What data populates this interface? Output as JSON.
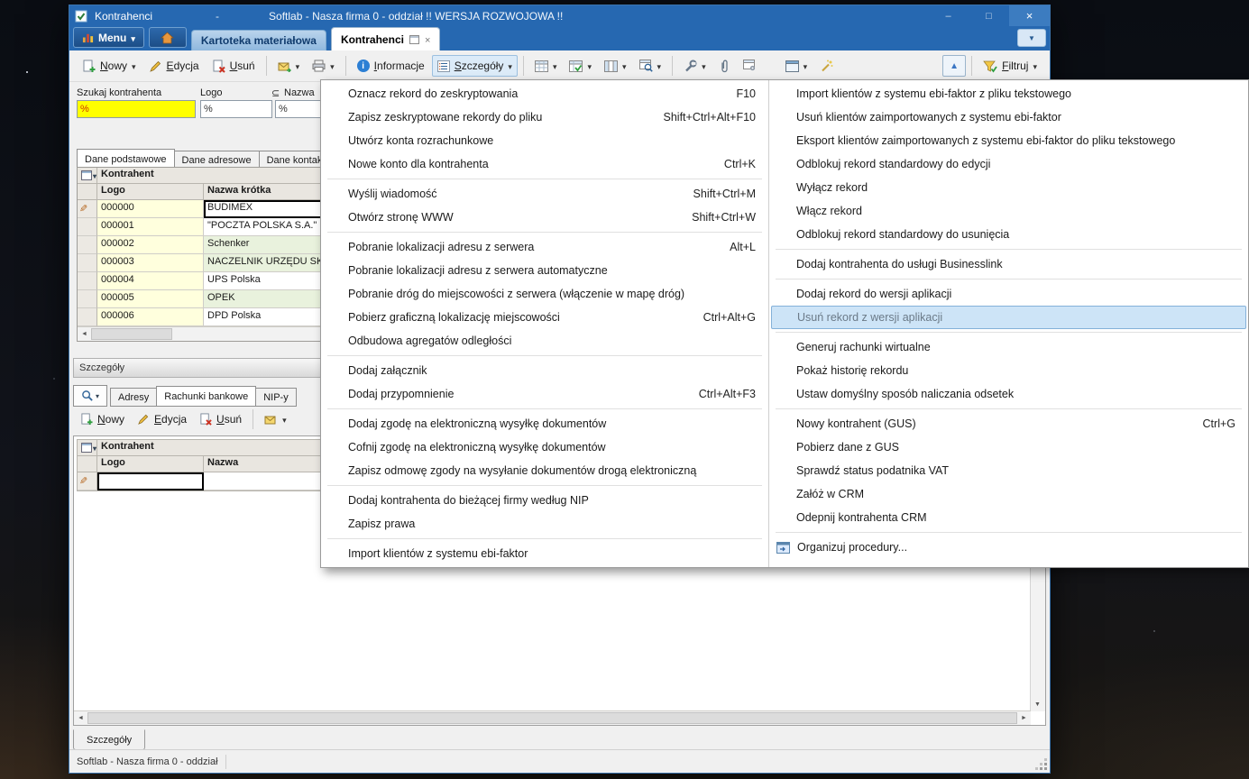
{
  "colors": {
    "titlebar": "#2668b1",
    "accent": "#2c7fd4",
    "search_highlight": "#ffff00",
    "grid_logo_cell": "#ffffdd",
    "grid_alt_row": "#e9f2dd",
    "menu_highlight_bg": "#cde4f7",
    "menu_highlight_border": "#84b1d9"
  },
  "icons": [
    "app-check-icon",
    "bar-chart-icon",
    "home-icon",
    "new-doc-icon",
    "pencil-icon",
    "delete-doc-icon",
    "envelope-icon",
    "printer-icon",
    "info-icon",
    "list-icon",
    "grid-icon",
    "grid-check-icon",
    "columns-icon",
    "grid-search-icon",
    "wrench-icon",
    "paperclip-icon",
    "grid-gear-icon",
    "window-icon",
    "magic-wand-icon",
    "up-arrow-icon",
    "funnel-icon",
    "magnifier-icon",
    "procedures-icon"
  ],
  "window": {
    "app_name": "Kontrahenci",
    "separator": "-",
    "title": "Softlab - Nasza firma 0 - oddział !! WERSJA ROZWOJOWA !!",
    "controls": {
      "minimize": "–",
      "maximize": "□",
      "close": "×"
    }
  },
  "menubar": {
    "menu_label": "Menu",
    "tabs": [
      {
        "label": "Kartoteka materiałowa"
      },
      {
        "label": "Kontrahenci"
      }
    ]
  },
  "toolbar": {
    "nowy": "Nowy",
    "edycja": "Edycja",
    "usun": "Usuń",
    "informacje": "Informacje",
    "szczegoly": "Szczegóły",
    "filtruj": "Filtruj"
  },
  "search": {
    "operator": "⊆",
    "fields": [
      {
        "label": "Szukaj kontrahenta",
        "value": "%"
      },
      {
        "label": "Logo",
        "value": "%"
      },
      {
        "label": "Nazwa",
        "value": "%"
      }
    ]
  },
  "main_tabs": [
    {
      "label": "Dane podstawowe"
    },
    {
      "label": "Dane adresowe"
    },
    {
      "label": "Dane kontaktowe"
    }
  ],
  "grid": {
    "group_header": "Kontrahent",
    "columns": [
      "Logo",
      "Nazwa krótka"
    ],
    "rows": [
      {
        "logo": "000000",
        "nazwa": "BUDIMEX"
      },
      {
        "logo": "000001",
        "nazwa": "\"POCZTA POLSKA S.A.\""
      },
      {
        "logo": "000002",
        "nazwa": "Schenker"
      },
      {
        "logo": "000003",
        "nazwa": "NACZELNIK URZĘDU SK"
      },
      {
        "logo": "000004",
        "nazwa": "UPS Polska"
      },
      {
        "logo": "000005",
        "nazwa": "OPEK"
      },
      {
        "logo": "000006",
        "nazwa": "DPD Polska"
      }
    ]
  },
  "details": {
    "panel_header": "Szczegóły",
    "tabs": [
      {
        "label": "Adresy"
      },
      {
        "label": "Rachunki bankowe"
      },
      {
        "label": "NIP-y"
      }
    ],
    "toolbar": {
      "nowy": "Nowy",
      "edycja": "Edycja",
      "usun": "Usuń"
    },
    "grid": {
      "group_header": "Kontrahent",
      "columns": [
        "Logo",
        "Nazwa"
      ]
    },
    "bottom_tab": "Szczegóły"
  },
  "context_menu": {
    "columns": [
      {
        "groups": [
          {
            "items": [
              {
                "label": "Oznacz rekord do zeskryptowania",
                "shortcut": "F10"
              },
              {
                "label": "Zapisz zeskryptowane rekordy do pliku",
                "shortcut": "Shift+Ctrl+Alt+F10"
              },
              {
                "label": "Utwórz konta rozrachunkowe"
              },
              {
                "label": "Nowe konto dla kontrahenta",
                "shortcut": "Ctrl+K"
              }
            ]
          },
          {
            "items": [
              {
                "label": "Wyślij wiadomość",
                "shortcut": "Shift+Ctrl+M"
              },
              {
                "label": "Otwórz stronę WWW",
                "shortcut": "Shift+Ctrl+W"
              }
            ]
          },
          {
            "items": [
              {
                "label": "Pobranie lokalizacji adresu z serwera",
                "shortcut": "Alt+L"
              },
              {
                "label": "Pobranie lokalizacji adresu z serwera automatyczne"
              },
              {
                "label": "Pobranie dróg do miejscowości z serwera (włączenie w mapę dróg)"
              },
              {
                "label": "Pobierz graficzną lokalizację miejscowości",
                "shortcut": "Ctrl+Alt+G"
              },
              {
                "label": "Odbudowa agregatów odległości"
              }
            ]
          },
          {
            "items": [
              {
                "label": "Dodaj załącznik"
              },
              {
                "label": "Dodaj przypomnienie",
                "shortcut": "Ctrl+Alt+F3"
              }
            ]
          },
          {
            "items": [
              {
                "label": "Dodaj zgodę na elektroniczną wysyłkę dokumentów"
              },
              {
                "label": "Cofnij zgodę na elektroniczną wysyłkę dokumentów"
              },
              {
                "label": "Zapisz odmowę zgody na wysyłanie dokumentów drogą elektroniczną"
              }
            ]
          },
          {
            "items": [
              {
                "label": "Dodaj kontrahenta do bieżącej firmy według NIP"
              },
              {
                "label": "Zapisz prawa"
              }
            ]
          },
          {
            "items": [
              {
                "label": "Import klientów z systemu ebi-faktor"
              }
            ]
          }
        ]
      },
      {
        "groups": [
          {
            "items": [
              {
                "label": "Import klientów z systemu ebi-faktor z pliku tekstowego"
              },
              {
                "label": "Usuń klientów zaimportowanych z systemu ebi-faktor"
              },
              {
                "label": "Eksport klientów zaimportowanych z systemu ebi-faktor do pliku tekstowego"
              },
              {
                "label": "Odblokuj rekord standardowy do edycji"
              },
              {
                "label": "Wyłącz rekord"
              },
              {
                "label": "Włącz rekord"
              },
              {
                "label": "Odblokuj rekord standardowy do usunięcia"
              }
            ]
          },
          {
            "items": [
              {
                "label": "Dodaj kontrahenta do usługi Businesslink"
              }
            ]
          },
          {
            "items": [
              {
                "label": "Dodaj rekord do wersji aplikacji"
              },
              {
                "label": "Usuń rekord z wersji aplikacji",
                "highlighted": true
              }
            ]
          },
          {
            "items": [
              {
                "label": "Generuj rachunki wirtualne"
              },
              {
                "label": "Pokaż historię rekordu"
              },
              {
                "label": "Ustaw domyślny sposób naliczania odsetek"
              }
            ]
          },
          {
            "items": [
              {
                "label": "Nowy kontrahent (GUS)",
                "shortcut": "Ctrl+G"
              },
              {
                "label": "Pobierz dane z GUS"
              },
              {
                "label": "Sprawdź status podatnika VAT"
              },
              {
                "label": "Załóż w CRM"
              },
              {
                "label": "Odepnij kontrahenta CRM"
              }
            ]
          },
          {
            "items": [
              {
                "label": "Organizuj procedury...",
                "icon": "procedures-icon"
              }
            ]
          }
        ]
      }
    ]
  },
  "statusbar": {
    "text": "Softlab - Nasza firma 0 - oddział"
  }
}
